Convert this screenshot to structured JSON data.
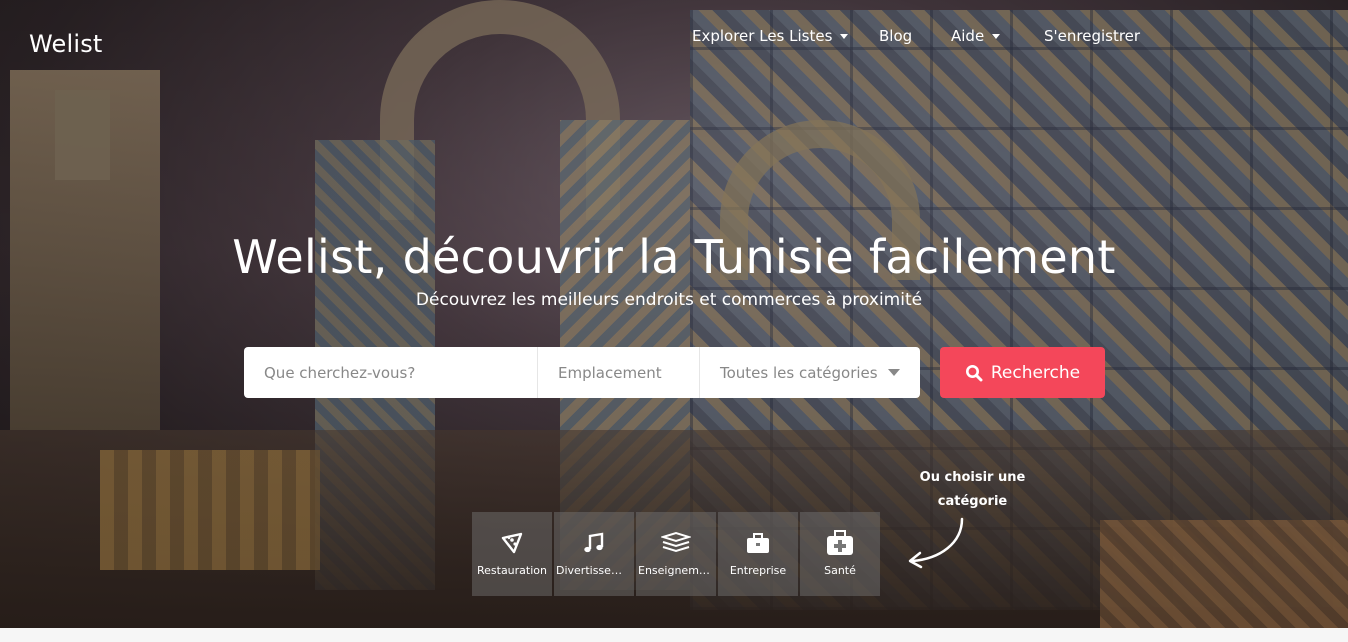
{
  "brand": {
    "logo_text": "Welist"
  },
  "nav": {
    "items": [
      {
        "label": "Explorer Les Listes",
        "has_caret": true
      },
      {
        "label": "Blog",
        "has_caret": false
      },
      {
        "label": "Aide",
        "has_caret": true
      },
      {
        "label": "S'enregistrer",
        "has_caret": false
      }
    ]
  },
  "hero": {
    "title": "Welist, découvrir la Tunisie facilement",
    "subtitle": "Découvrez les meilleurs endroits et commerces à proximité"
  },
  "search": {
    "what_placeholder": "Que cherchez-vous?",
    "location_placeholder": "Emplacement",
    "category_selected": "Toutes les catégories",
    "button_label": "Recherche"
  },
  "hint": {
    "line1": "Ou choisir une",
    "line2": "catégorie"
  },
  "categories": [
    {
      "label": "Restauration",
      "icon": "pizza-icon"
    },
    {
      "label": "Divertissement",
      "icon": "music-icon"
    },
    {
      "label": "Enseignement",
      "icon": "books-icon"
    },
    {
      "label": "Entreprise",
      "icon": "briefcase-icon"
    },
    {
      "label": "Santé",
      "icon": "medkit-icon"
    }
  ],
  "colors": {
    "accent": "#f4475a",
    "text_on_dark": "#ffffff"
  }
}
